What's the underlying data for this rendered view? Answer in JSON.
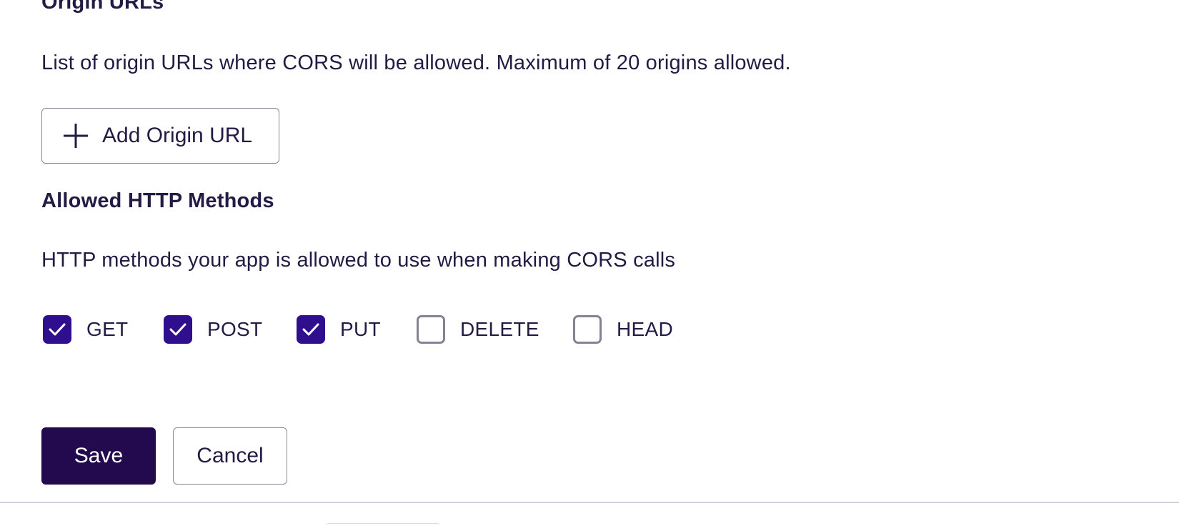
{
  "origin_urls": {
    "title": "Origin URLs",
    "description": "List of origin URLs where CORS will be allowed. Maximum of 20 origins allowed.",
    "add_button_label": "Add Origin URL",
    "add_icon": "plus-icon"
  },
  "methods": {
    "title": "Allowed HTTP Methods",
    "description": "HTTP methods your app is allowed to use when making CORS calls",
    "items": [
      {
        "label": "GET",
        "checked": true
      },
      {
        "label": "POST",
        "checked": true
      },
      {
        "label": "PUT",
        "checked": true
      },
      {
        "label": "DELETE",
        "checked": false
      },
      {
        "label": "HEAD",
        "checked": false
      }
    ],
    "check_icon": "checkmark-icon"
  },
  "actions": {
    "save_label": "Save",
    "cancel_label": "Cancel"
  },
  "colors": {
    "checkbox_checked": "#2f0f8e",
    "primary_button": "#230a4f",
    "text": "#241b45",
    "border": "#8a8799"
  }
}
